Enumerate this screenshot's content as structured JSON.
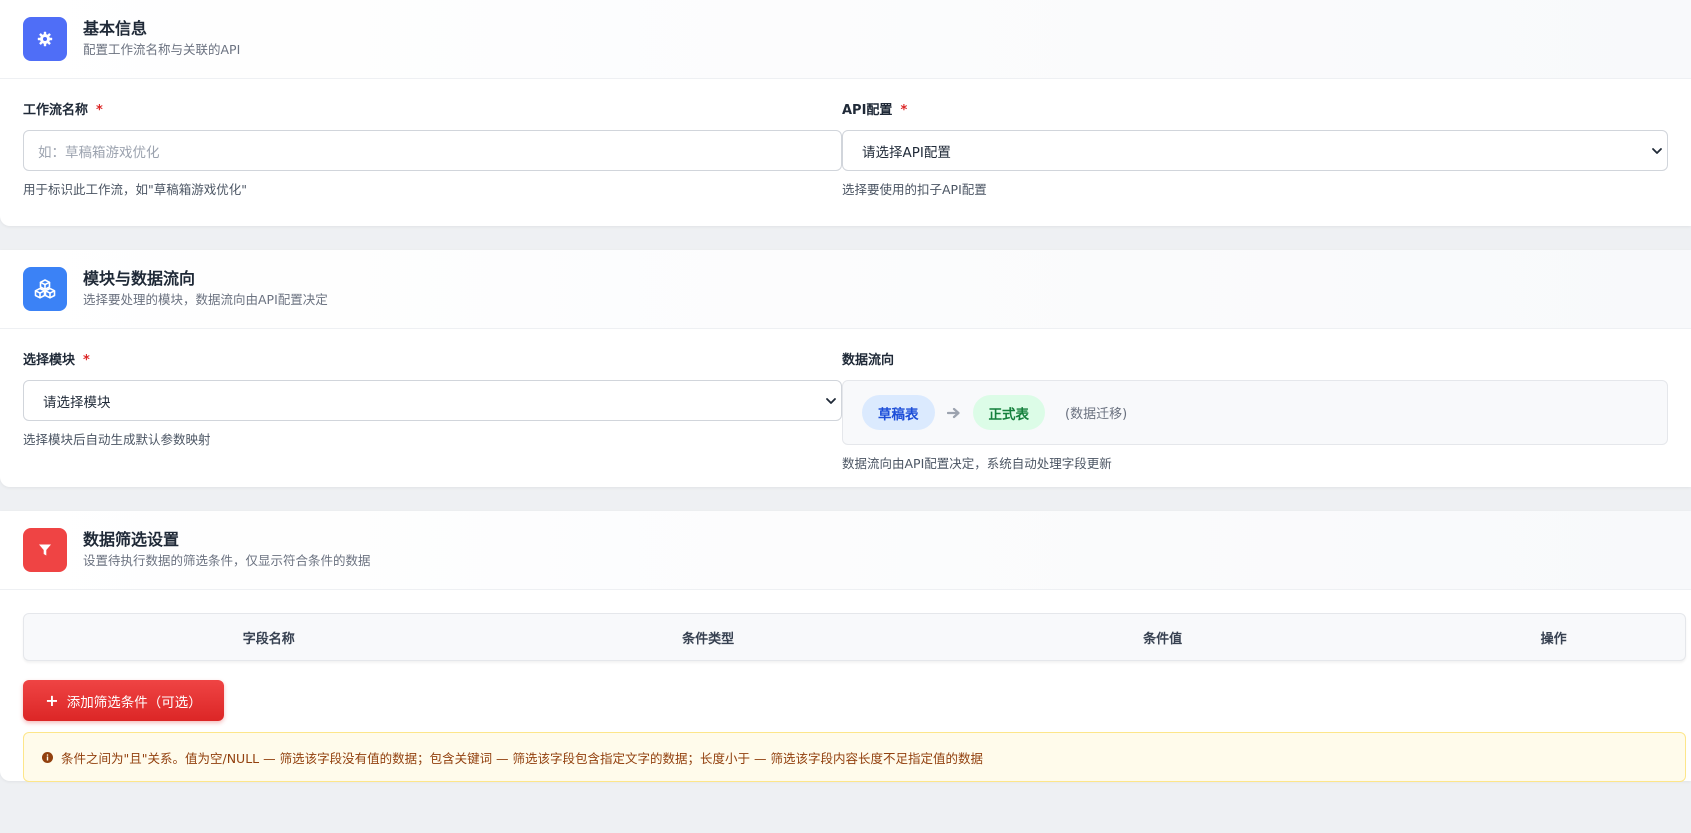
{
  "basic": {
    "title": "基本信息",
    "subtitle": "配置工作流名称与关联的API",
    "icon": "gear-icon",
    "icon_color": "#4f6ef7",
    "name_label": "工作流名称",
    "required_mark": "*",
    "name_placeholder": "如：草稿箱游戏优化",
    "name_hint": "用于标识此工作流，如\"草稿箱游戏优化\"",
    "api_label": "API配置",
    "api_selected": "请选择API配置",
    "api_hint": "选择要使用的扣子API配置"
  },
  "modules": {
    "title": "模块与数据流向",
    "subtitle": "选择要处理的模块，数据流向由API配置决定",
    "icon": "cubes-icon",
    "icon_color": "#3b82f6",
    "module_label": "选择模块",
    "required_mark": "*",
    "module_selected": "请选择模块",
    "module_hint": "选择模块后自动生成默认参数映射",
    "flow_label": "数据流向",
    "flow_from": "草稿表",
    "flow_to": "正式表",
    "flow_note": "(数据迁移)",
    "flow_hint": "数据流向由API配置决定，系统自动处理字段更新"
  },
  "filter": {
    "title": "数据筛选设置",
    "subtitle": "设置待执行数据的筛选条件，仅显示符合条件的数据",
    "icon": "filter-icon",
    "icon_color": "#ef4444",
    "columns": [
      "字段名称",
      "条件类型",
      "条件值",
      "操作"
    ],
    "add_button": "添加筛选条件（可选）",
    "notice": "条件之间为\"且\"关系。值为空/NULL — 筛选该字段没有值的数据；包含关键词 — 筛选该字段包含指定文字的数据；长度小于 — 筛选该字段内容长度不足指定值的数据"
  }
}
